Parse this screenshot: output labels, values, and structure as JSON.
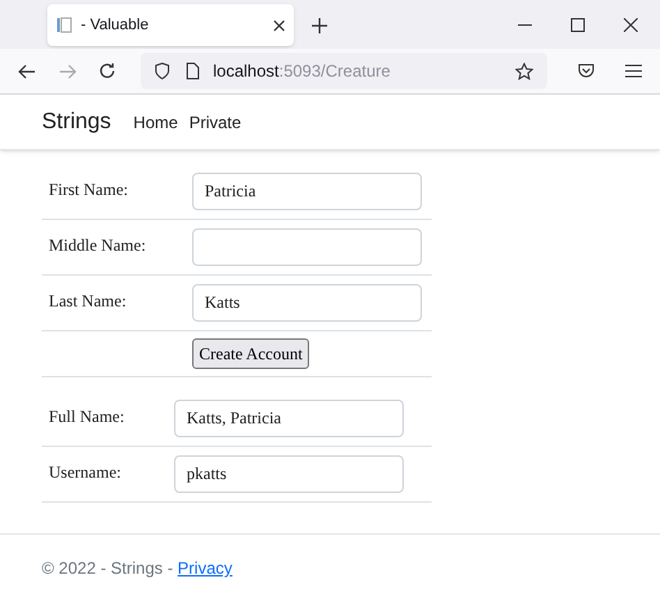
{
  "browser": {
    "tab_title": "- Valuable",
    "url_host": "localhost",
    "url_path": ":5093/Creature"
  },
  "navbar": {
    "brand": "Strings",
    "links": [
      "Home",
      "Private"
    ]
  },
  "account_form": {
    "fields": [
      {
        "label": "First Name:",
        "value": "Patricia"
      },
      {
        "label": "Middle Name:"
      },
      {
        "label": "Last Name:",
        "value": "Katts"
      }
    ],
    "button": "Create Account"
  },
  "result_form": {
    "fields": [
      {
        "label": "Full Name:",
        "value": "Katts, Patricia"
      },
      {
        "label": "Username:",
        "value": "pkatts"
      }
    ]
  },
  "footer": {
    "text": "© 2022 - Strings - ",
    "link": "Privacy"
  }
}
